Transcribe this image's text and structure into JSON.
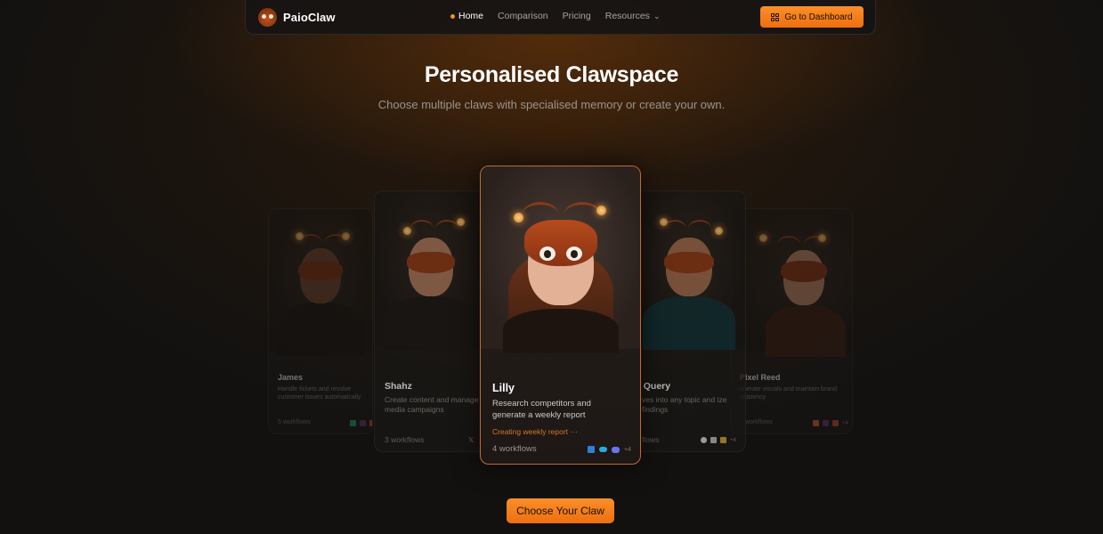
{
  "nav": {
    "brand": "PaioClaw",
    "items": [
      {
        "label": "Home",
        "active": true
      },
      {
        "label": "Comparison"
      },
      {
        "label": "Pricing"
      },
      {
        "label": "Resources",
        "dropdown": true
      }
    ],
    "dashboard_button": "Go to Dashboard"
  },
  "hero": {
    "title": "Personalised Clawspace",
    "subtitle": "Choose multiple claws with specialised memory or create your own."
  },
  "cards": [
    {
      "name": "James",
      "description": "Handle tickets and resolve customer issues automatically",
      "workflows": "5 workflows"
    },
    {
      "name": "Shahz",
      "description": "Create content and manage media campaigns",
      "workflows": "3 workflows"
    },
    {
      "name": "Lilly",
      "description": "Research competitors and generate a weekly report",
      "status": "Creating weekly report ···",
      "workflows": "4 workflows",
      "extra": "+4"
    },
    {
      "name": "s Query",
      "description": "ves into any topic and ize findings",
      "workflows": "flows",
      "extra": "+4"
    },
    {
      "name": "Pixel Reed",
      "description": "enerate visuals and maintain brand nsistency",
      "workflows": "workflows",
      "extra": "+4"
    }
  ],
  "cta": "Choose Your Claw",
  "colors": {
    "accent": "#f6921e",
    "background": "#121110"
  }
}
